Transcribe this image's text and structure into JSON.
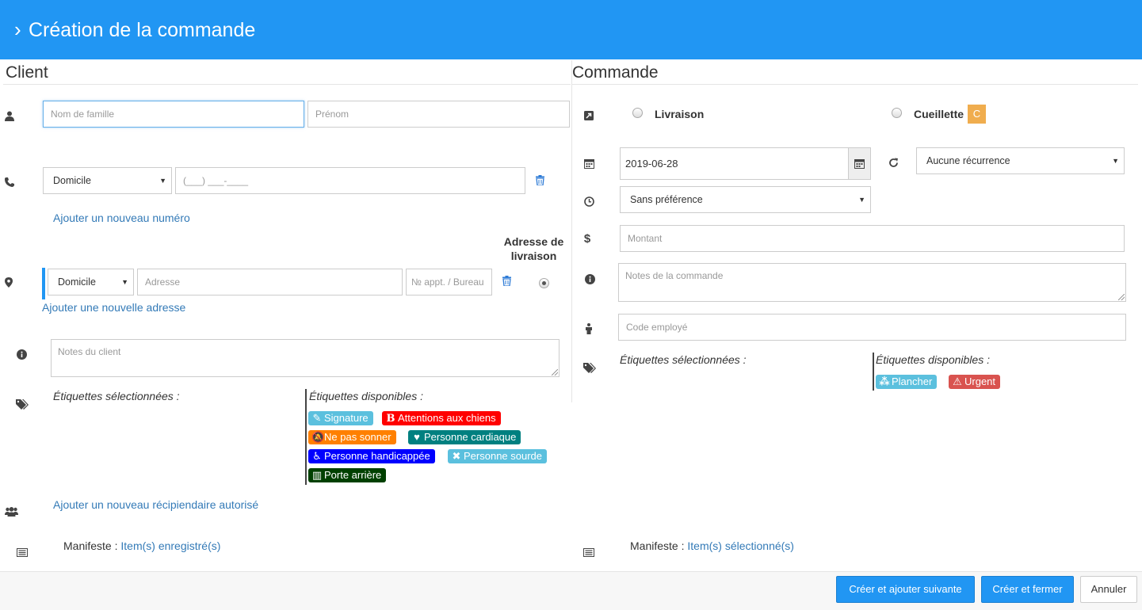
{
  "header": {
    "chevron": "›",
    "title": "Création de la commande"
  },
  "client": {
    "section_title": "Client",
    "last_name_placeholder": "Nom de famille",
    "first_name_placeholder": "Prénom",
    "phone_type": "Domicile",
    "phone_mask": "(___) ___-____",
    "add_phone_link": "Ajouter un nouveau numéro",
    "delivery_address_label_1": "Adresse de",
    "delivery_address_label_2": "livraison",
    "address_type": "Domicile",
    "address_placeholder": "Adresse",
    "apt_placeholder": "№ appt. / Bureau",
    "add_address_link": "Ajouter une nouvelle adresse",
    "notes_placeholder": "Notes du client",
    "selected_tags_label": "Étiquettes sélectionnées :",
    "available_tags_label": "Étiquettes disponibles :",
    "tags": [
      {
        "label": "Signature",
        "icon": "edit-icon",
        "color": "#5bc0de"
      },
      {
        "label": "Attentions aux chiens",
        "icon": "b-icon",
        "color": "#ff0000"
      },
      {
        "label": "Ne pas sonner",
        "icon": "bell-slash-icon",
        "color": "#ff8000"
      },
      {
        "label": "Personne cardiaque",
        "icon": "heartbeat-icon",
        "color": "#008080"
      },
      {
        "label": "Personne handicappée",
        "icon": "wheelchair-icon",
        "color": "#0000ff"
      },
      {
        "label": "Personne sourde",
        "icon": "times-icon",
        "color": "#5bc0de"
      },
      {
        "label": "Porte arrière",
        "icon": "barcode-icon",
        "color": "#004000"
      }
    ],
    "add_recipient_link": "Ajouter un nouveau récipiendaire autorisé",
    "manifest_label": "Manifeste :",
    "manifest_link": "Item(s) enregistré(s)"
  },
  "order": {
    "section_title": "Commande",
    "delivery_label": "Livraison",
    "pickup_label": "Cueillette",
    "pickup_badge": "C",
    "pickup_badge_color": "#f0ad4e",
    "date_value": "2019-06-28",
    "recurrence": "Aucune récurrence",
    "time_preference": "Sans préférence",
    "amount_placeholder": "Montant",
    "notes_placeholder": "Notes de la commande",
    "employee_placeholder": "Code employé",
    "selected_tags_label": "Étiquettes sélectionnées :",
    "available_tags_label": "Étiquettes disponibles :",
    "tags": [
      {
        "label": "Plancher",
        "icon": "cubes-icon",
        "color": "#5bc0de"
      },
      {
        "label": "Urgent",
        "icon": "warning-icon",
        "color": "#d9534f"
      }
    ],
    "manifest_label": "Manifeste :",
    "manifest_link": "Item(s) sélectionné(s)"
  },
  "footer": {
    "create_next": "Créer et ajouter suivante",
    "create_close": "Créer et fermer",
    "cancel": "Annuler"
  },
  "colors": {
    "accent": "#2196f3",
    "link": "#337ab7"
  }
}
